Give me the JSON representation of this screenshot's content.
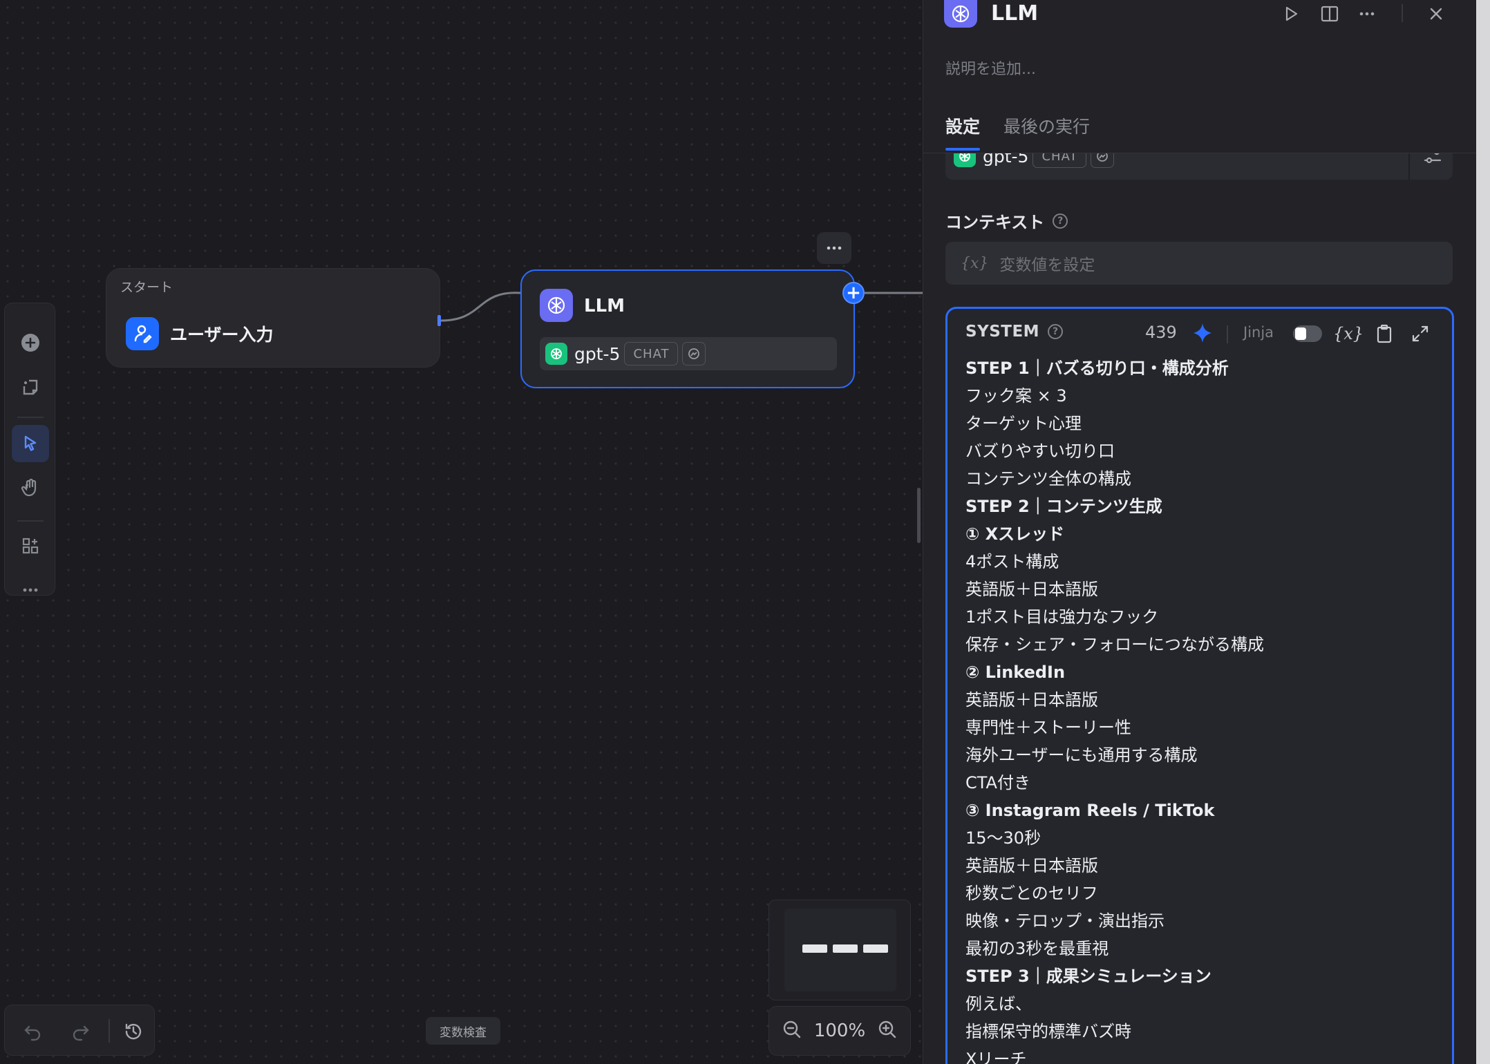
{
  "canvas": {
    "start_node": {
      "label": "スタート",
      "title": "ユーザー入力"
    },
    "llm_node": {
      "title": "LLM",
      "model": "gpt-5",
      "mode": "CHAT"
    },
    "var_inspect_label": "変数検査",
    "zoom_level": "100%"
  },
  "panel": {
    "title": "LLM",
    "description_placeholder": "説明を追加...",
    "tabs": [
      {
        "label": "設定",
        "active": true
      },
      {
        "label": "最後の実行",
        "active": false
      }
    ],
    "model": {
      "name": "gpt-5",
      "mode": "CHAT"
    },
    "context": {
      "label": "コンテキスト",
      "placeholder": "変数値を設定",
      "var_glyph": "{x}"
    },
    "system": {
      "label": "SYSTEM",
      "char_count": "439",
      "jinja_label": "Jinja",
      "jinja_enabled": false,
      "var_glyph": "{x}",
      "lines": [
        {
          "text": "STEP 1｜バズる切り口・構成分析",
          "bold": true
        },
        {
          "text": "フック案 × 3",
          "bold": false
        },
        {
          "text": "ターゲット心理",
          "bold": false
        },
        {
          "text": "バズりやすい切り口",
          "bold": false
        },
        {
          "text": "コンテンツ全体の構成",
          "bold": false
        },
        {
          "text": "STEP 2｜コンテンツ生成",
          "bold": true
        },
        {
          "text": "① Xスレッド",
          "bold": true
        },
        {
          "text": "4ポスト構成",
          "bold": false
        },
        {
          "text": "英語版＋日本語版",
          "bold": false
        },
        {
          "text": "1ポスト目は強力なフック",
          "bold": false
        },
        {
          "text": "保存・シェア・フォローにつながる構成",
          "bold": false
        },
        {
          "text": "② LinkedIn",
          "bold": true
        },
        {
          "text": "英語版＋日本語版",
          "bold": false
        },
        {
          "text": "専門性＋ストーリー性",
          "bold": false
        },
        {
          "text": "海外ユーザーにも通用する構成",
          "bold": false
        },
        {
          "text": "CTA付き",
          "bold": false
        },
        {
          "text": "③ Instagram Reels / TikTok",
          "bold": true
        },
        {
          "text": "15〜30秒",
          "bold": false
        },
        {
          "text": "英語版＋日本語版",
          "bold": false
        },
        {
          "text": "秒数ごとのセリフ",
          "bold": false
        },
        {
          "text": "映像・テロップ・演出指示",
          "bold": false
        },
        {
          "text": "最初の3秒を最重視",
          "bold": false
        },
        {
          "text": "STEP 3｜成果シミュレーション",
          "bold": true
        },
        {
          "text": "例えば、",
          "bold": false
        },
        {
          "text": "指標保守的標準バズ時",
          "bold": false
        },
        {
          "text": "Xリーチ",
          "bold": false
        }
      ]
    }
  },
  "colors": {
    "accent": "#2c6bff",
    "llm_icon": "#6a6cf2",
    "openai": "#19c37d",
    "start_icon": "#1f6bff"
  }
}
